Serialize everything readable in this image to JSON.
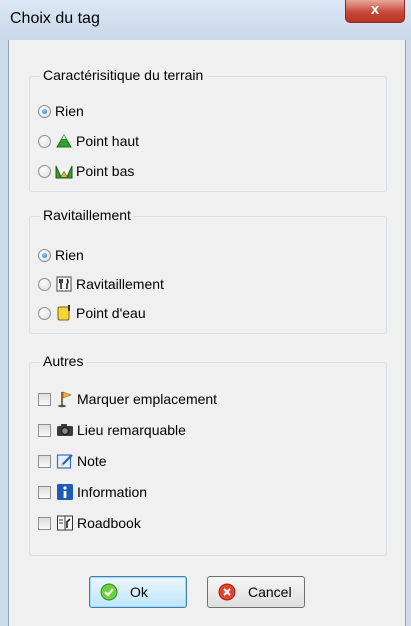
{
  "window": {
    "title": "Choix du tag",
    "close_glyph": "x"
  },
  "terrain": {
    "legend": "Caractérisitique du terrain",
    "options": [
      {
        "label": "Rien",
        "checked": true,
        "icon": ""
      },
      {
        "label": "Point haut",
        "checked": false,
        "icon": "mountain-icon"
      },
      {
        "label": "Point bas",
        "checked": false,
        "icon": "valley-icon"
      }
    ]
  },
  "ravitaillement": {
    "legend": "Ravitaillement",
    "options": [
      {
        "label": "Rien",
        "checked": true,
        "icon": ""
      },
      {
        "label": "Ravitaillement",
        "checked": false,
        "icon": "fork-knife-icon"
      },
      {
        "label": "Point d'eau",
        "checked": false,
        "icon": "water-cup-icon"
      }
    ]
  },
  "autres": {
    "legend": "Autres",
    "options": [
      {
        "label": "Marquer emplacement",
        "checked": false,
        "icon": "flag-icon"
      },
      {
        "label": "Lieu remarquable",
        "checked": false,
        "icon": "camera-icon"
      },
      {
        "label": "Note",
        "checked": false,
        "icon": "note-icon"
      },
      {
        "label": "Information",
        "checked": false,
        "icon": "info-icon"
      },
      {
        "label": "Roadbook",
        "checked": false,
        "icon": "roadbook-icon"
      }
    ]
  },
  "buttons": {
    "ok": "Ok",
    "cancel": "Cancel"
  }
}
